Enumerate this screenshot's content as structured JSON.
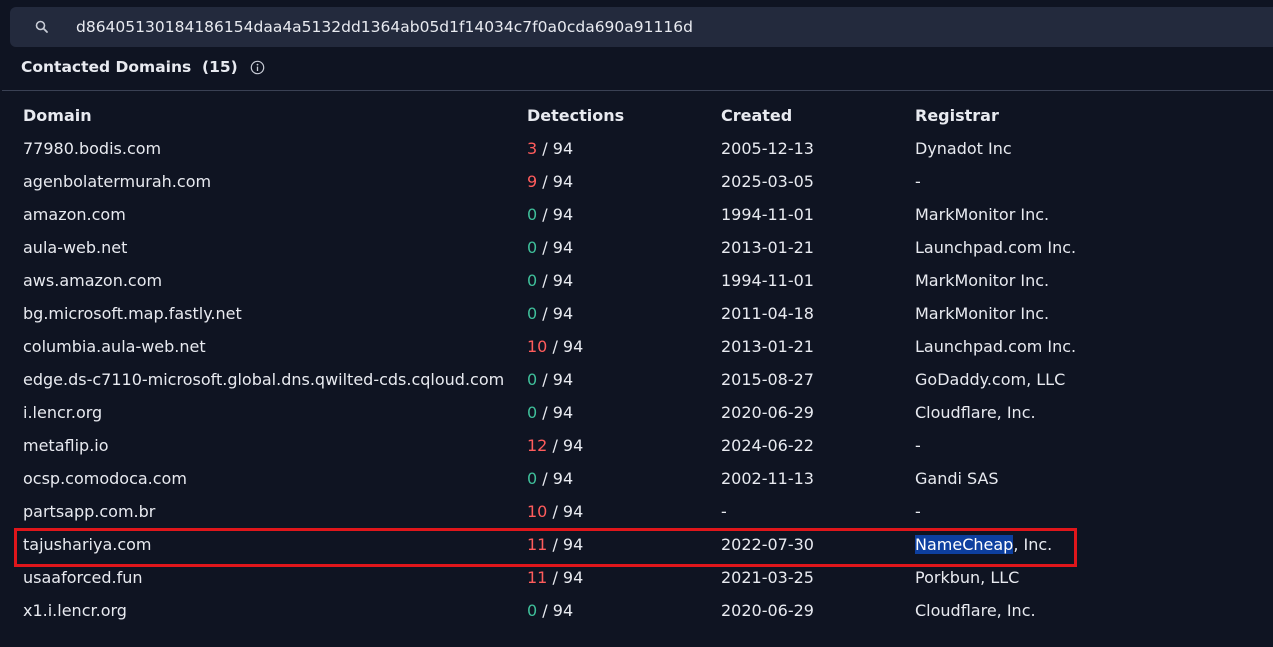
{
  "search": {
    "value": "d86405130184186154daa4a5132dd1364ab05d1f14034c7f0a0cda690a91116d"
  },
  "section": {
    "title": "Contacted Domains",
    "count": "(15)"
  },
  "table": {
    "headers": {
      "domain": "Domain",
      "detections": "Detections",
      "created": "Created",
      "registrar": "Registrar"
    },
    "rows": [
      {
        "domain": "77980.bodis.com",
        "detections": "3",
        "total": "/ 94",
        "status": "red",
        "created": "2005-12-13",
        "registrar": "Dynadot Inc"
      },
      {
        "domain": "agenbolatermurah.com",
        "detections": "9",
        "total": "/ 94",
        "status": "red",
        "created": "2025-03-05",
        "registrar": "-"
      },
      {
        "domain": "amazon.com",
        "detections": "0",
        "total": "/ 94",
        "status": "green",
        "created": "1994-11-01",
        "registrar": "MarkMonitor Inc."
      },
      {
        "domain": "aula-web.net",
        "detections": "0",
        "total": "/ 94",
        "status": "green",
        "created": "2013-01-21",
        "registrar": "Launchpad.com Inc."
      },
      {
        "domain": "aws.amazon.com",
        "detections": "0",
        "total": "/ 94",
        "status": "green",
        "created": "1994-11-01",
        "registrar": "MarkMonitor Inc."
      },
      {
        "domain": "bg.microsoft.map.fastly.net",
        "detections": "0",
        "total": "/ 94",
        "status": "green",
        "created": "2011-04-18",
        "registrar": "MarkMonitor Inc."
      },
      {
        "domain": "columbia.aula-web.net",
        "detections": "10",
        "total": "/ 94",
        "status": "red",
        "created": "2013-01-21",
        "registrar": "Launchpad.com Inc."
      },
      {
        "domain": "edge.ds-c7110-microsoft.global.dns.qwilted-cds.cqloud.com",
        "detections": "0",
        "total": "/ 94",
        "status": "green",
        "created": "2015-08-27",
        "registrar": "GoDaddy.com, LLC"
      },
      {
        "domain": "i.lencr.org",
        "detections": "0",
        "total": "/ 94",
        "status": "green",
        "created": "2020-06-29",
        "registrar": "Cloudflare, Inc."
      },
      {
        "domain": "metaflip.io",
        "detections": "12",
        "total": "/ 94",
        "status": "red",
        "created": "2024-06-22",
        "registrar": "-"
      },
      {
        "domain": "ocsp.comodoca.com",
        "detections": "0",
        "total": "/ 94",
        "status": "green",
        "created": "2002-11-13",
        "registrar": "Gandi SAS"
      },
      {
        "domain": "partsapp.com.br",
        "detections": "10",
        "total": "/ 94",
        "status": "red",
        "created": "-",
        "registrar": "-"
      },
      {
        "domain": "tajushariya.com",
        "detections": "11",
        "total": "/ 94",
        "status": "red",
        "created": "2022-07-30",
        "registrar_selected": "NameCheap",
        "registrar_rest": ", Inc."
      },
      {
        "domain": "usaaforced.fun",
        "detections": "11",
        "total": "/ 94",
        "status": "red",
        "created": "2021-03-25",
        "registrar": "Porkbun, LLC"
      },
      {
        "domain": "x1.i.lencr.org",
        "detections": "0",
        "total": "/ 94",
        "status": "green",
        "created": "2020-06-29",
        "registrar": "Cloudflare, Inc."
      }
    ]
  },
  "icons": {
    "search": "search-icon",
    "info": "info-icon"
  },
  "colors": {
    "background": "#0f1422",
    "search_bg": "#232a3d",
    "detection_positive": "#ff5c5c",
    "detection_zero": "#3fbf9a",
    "annotation_box": "#e0161b",
    "selection": "#0d3f9f"
  }
}
